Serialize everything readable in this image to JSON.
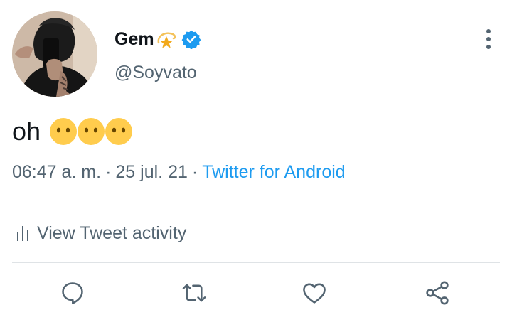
{
  "user": {
    "display_name": "Gem",
    "name_emoji": "dizzy-star-emoji",
    "verified_icon": "verified-badge-icon",
    "handle": "@Soyvato"
  },
  "tweet": {
    "text": "oh",
    "emojis": [
      "no-mouth-face-emoji",
      "no-mouth-face-emoji",
      "no-mouth-face-emoji"
    ]
  },
  "meta": {
    "time": "06:47 a. m.",
    "separator": "·",
    "date": "25 jul. 21",
    "source": "Twitter for Android"
  },
  "activity": {
    "icon": "bar-chart-icon",
    "label": "View Tweet activity"
  },
  "actions": [
    {
      "name": "reply",
      "icon": "reply-icon"
    },
    {
      "name": "retweet",
      "icon": "retweet-icon"
    },
    {
      "name": "like",
      "icon": "heart-icon"
    },
    {
      "name": "share",
      "icon": "share-icon"
    }
  ],
  "colors": {
    "text": "#0f1419",
    "secondary": "#536471",
    "link": "#1d9bf0",
    "verified": "#1d9bf0",
    "divider": "#dfe3e6"
  }
}
